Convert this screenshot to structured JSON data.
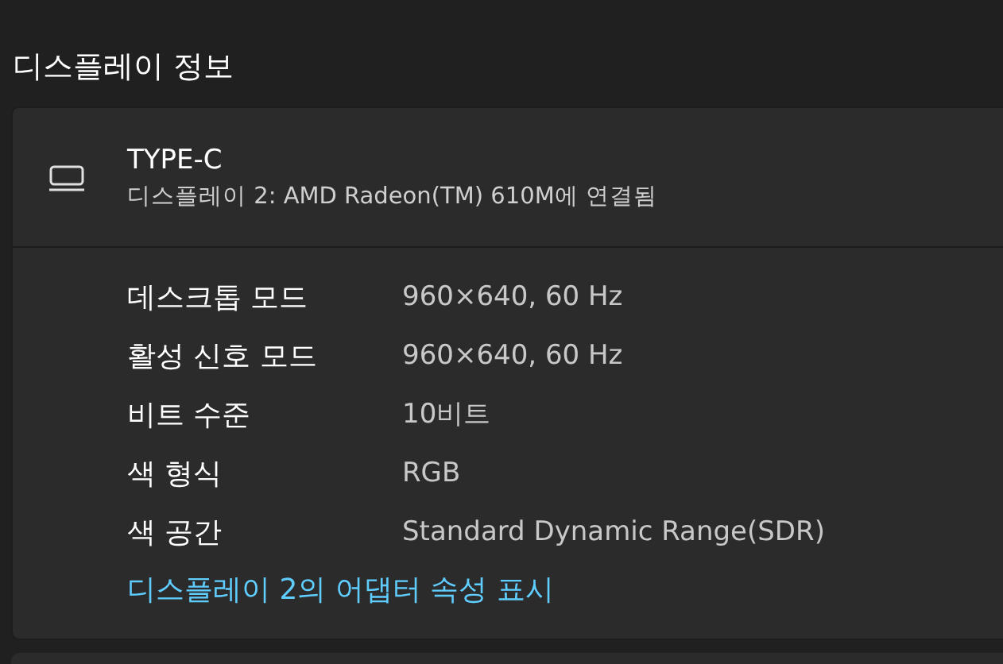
{
  "section_title": "디스플레이 정보",
  "display": {
    "name": "TYPE-C",
    "subtitle": "디스플레이 2: AMD Radeon(TM) 610M에 연결됨"
  },
  "properties": [
    {
      "label": "데스크톱 모드",
      "value": "960×640, 60 Hz"
    },
    {
      "label": "활성 신호 모드",
      "value": "960×640, 60 Hz"
    },
    {
      "label": "비트 수준",
      "value": "10비트"
    },
    {
      "label": "색 형식",
      "value": "RGB"
    },
    {
      "label": "색 공간",
      "value": "Standard Dynamic Range(SDR)"
    }
  ],
  "link": "디스플레이 2의 어댑터 속성 표시"
}
